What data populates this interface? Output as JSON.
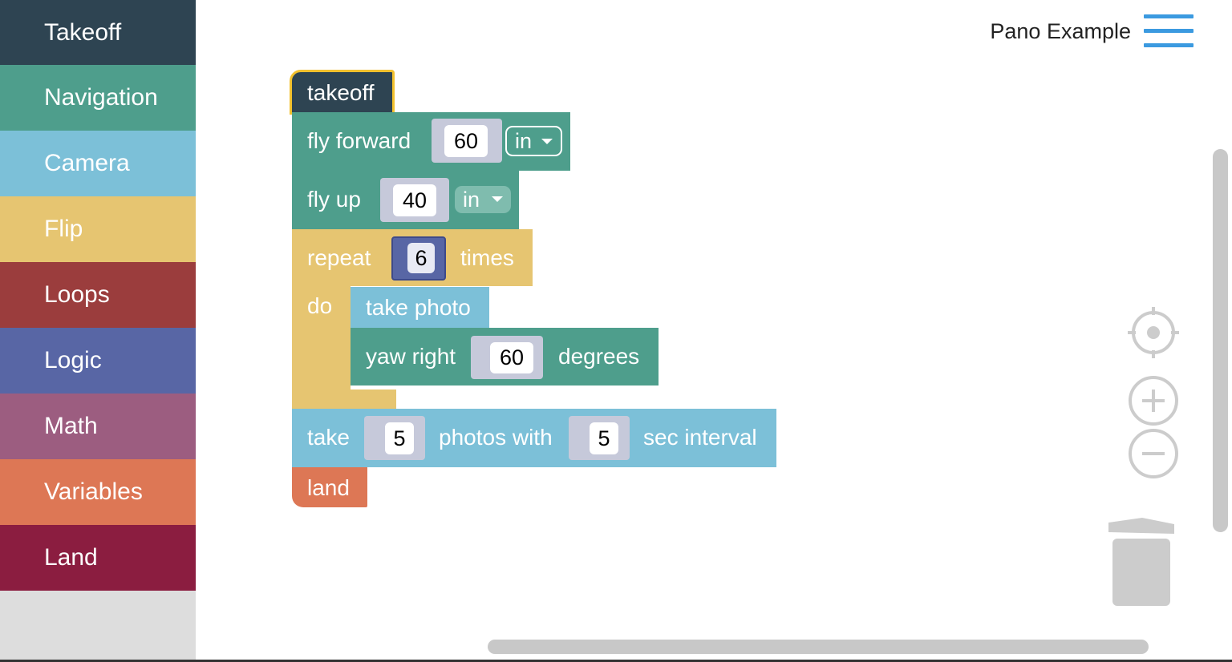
{
  "sidebar": {
    "categories": [
      {
        "label": "Takeoff",
        "color": "#2e4452"
      },
      {
        "label": "Navigation",
        "color": "#4e9e8c"
      },
      {
        "label": "Camera",
        "color": "#7cc0d8"
      },
      {
        "label": "Flip",
        "color": "#e6c571"
      },
      {
        "label": "Loops",
        "color": "#9b3d3d"
      },
      {
        "label": "Logic",
        "color": "#5866a5"
      },
      {
        "label": "Math",
        "color": "#9c5d80"
      },
      {
        "label": "Variables",
        "color": "#dd7755"
      },
      {
        "label": "Land",
        "color": "#8b1d40"
      }
    ]
  },
  "header": {
    "project_title": "Pano Example"
  },
  "workspace": {
    "takeoff": {
      "label": "takeoff"
    },
    "fly_forward": {
      "label": "fly forward",
      "value": "60",
      "unit": "in"
    },
    "fly_up": {
      "label": "fly up",
      "value": "40",
      "unit": "in"
    },
    "repeat": {
      "label": "repeat",
      "count": "6",
      "suffix": "times",
      "do_label": "do"
    },
    "take_photo": {
      "label": "take photo"
    },
    "yaw_right": {
      "label": "yaw right",
      "value": "60",
      "suffix": "degrees"
    },
    "take_photos": {
      "label": "take",
      "count": "5",
      "middle": "photos with",
      "interval": "5",
      "suffix": "sec interval"
    },
    "land": {
      "label": "land"
    }
  },
  "controls": {
    "icons": [
      "recenter-icon",
      "zoom-in-icon",
      "zoom-out-icon",
      "trash-icon"
    ]
  }
}
